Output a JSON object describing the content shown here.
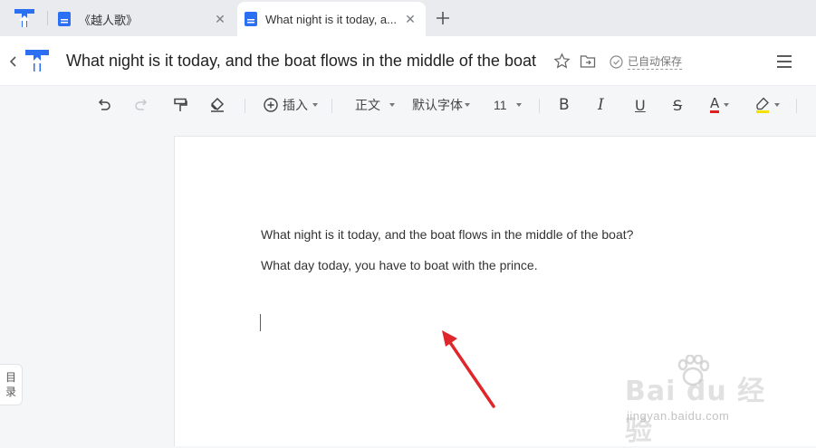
{
  "tabs": [
    {
      "title": "《越人歌》",
      "close": "✕"
    },
    {
      "title": "What night is it today, a...",
      "close": "✕"
    }
  ],
  "document": {
    "title": "What night is it today, and the boat flows in the middle of the boat",
    "save_status": "已自动保存",
    "lines": [
      "What night is it today, and the boat flows in the middle of the boat?",
      "What day today, you have to boat with the prince."
    ]
  },
  "toolbar": {
    "insert_label": "插入",
    "style_label": "正文",
    "font_label": "默认字体",
    "size_label": "11",
    "bold": "B",
    "italic": "I",
    "underline": "U",
    "strike": "S",
    "font_color": "A"
  },
  "sidebar": {
    "outline_label_1": "目",
    "outline_label_2": "录"
  },
  "watermark": {
    "main": "Bai du 经验",
    "sub": "jingyan.baidu.com"
  },
  "colors": {
    "brand": "#2b6ff2",
    "font_color_bar": "#e02020",
    "highlight_bar": "#f5e10a",
    "arrow": "#e0262b"
  }
}
